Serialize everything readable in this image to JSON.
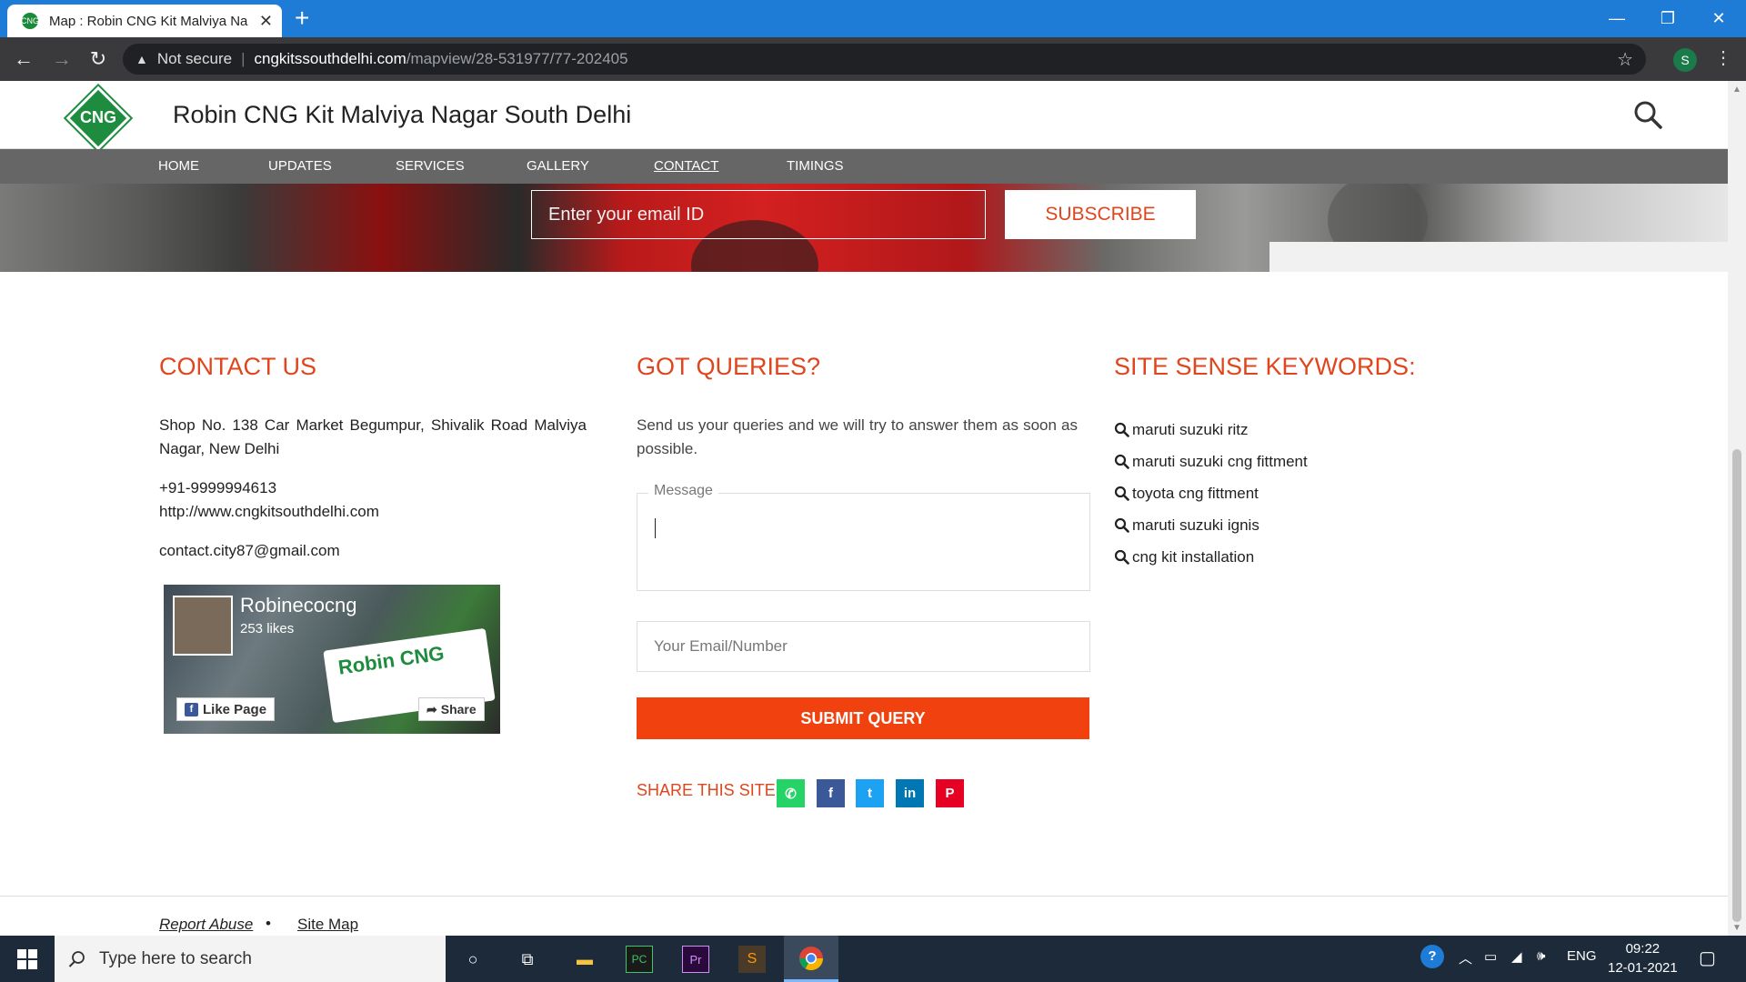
{
  "browser": {
    "tab_title": "Map : Robin CNG Kit Malviya Na",
    "favicon_text": "CNG",
    "warning_label": "Not secure",
    "url_domain": "cngkitssouthdelhi.com",
    "url_path": "/mapview/28-531977/77-202405",
    "profile_initial": "S"
  },
  "site": {
    "logo_text": "CNG",
    "title": "Robin CNG Kit Malviya Nagar South Delhi",
    "nav": [
      "HOME",
      "UPDATES",
      "SERVICES",
      "GALLERY",
      "CONTACT",
      "TIMINGS"
    ]
  },
  "subscribe": {
    "placeholder": "Enter your email ID",
    "button": "SUBSCRIBE"
  },
  "contact": {
    "title": "CONTACT US",
    "address": "Shop No. 138 Car Market Begumpur, Shivalik Road Malviya Nagar,  New Delhi",
    "phone": "+91-9999994613",
    "website": "http://www.cngkitsouthdelhi.com",
    "email": "contact.city87@gmail.com",
    "fb": {
      "name": "Robinecocng",
      "likes": "253 likes",
      "banner_text": "Robin CNG",
      "like_label": "Like Page",
      "share_label": "Share"
    }
  },
  "queries": {
    "title": "GOT QUERIES?",
    "text": "Send us your queries and we will try to answer them as soon as possible.",
    "message_label": "Message",
    "email_placeholder": "Your Email/Number",
    "submit": "SUBMIT QUERY",
    "share_label": "SHARE THIS SITE",
    "share_buttons": [
      {
        "icon": "whatsapp-icon",
        "glyph": "✆",
        "color": "#25d366"
      },
      {
        "icon": "facebook-icon",
        "glyph": "f",
        "color": "#3b5998"
      },
      {
        "icon": "twitter-icon",
        "glyph": "t",
        "color": "#1da1f2"
      },
      {
        "icon": "linkedin-icon",
        "glyph": "in",
        "color": "#0077b5"
      },
      {
        "icon": "pinterest-icon",
        "glyph": "P",
        "color": "#e60023"
      }
    ]
  },
  "keywords": {
    "title": "SITE SENSE KEYWORDS:",
    "items": [
      "maruti suzuki ritz",
      "maruti suzuki cng fittment",
      "toyota cng fittment",
      "maruti suzuki ignis",
      "cng kit installation"
    ]
  },
  "footer": {
    "report_abuse": "Report Abuse",
    "dot": "•",
    "site_map": "Site Map"
  },
  "taskbar": {
    "search_placeholder": "Type here to search",
    "language": "ENG",
    "time": "09:22",
    "date": "12-01-2021"
  },
  "colors": {
    "accent": "#e0451d",
    "submit": "#f0410e",
    "nav_bg": "#666666",
    "browser_blue": "#1e7bd6"
  }
}
